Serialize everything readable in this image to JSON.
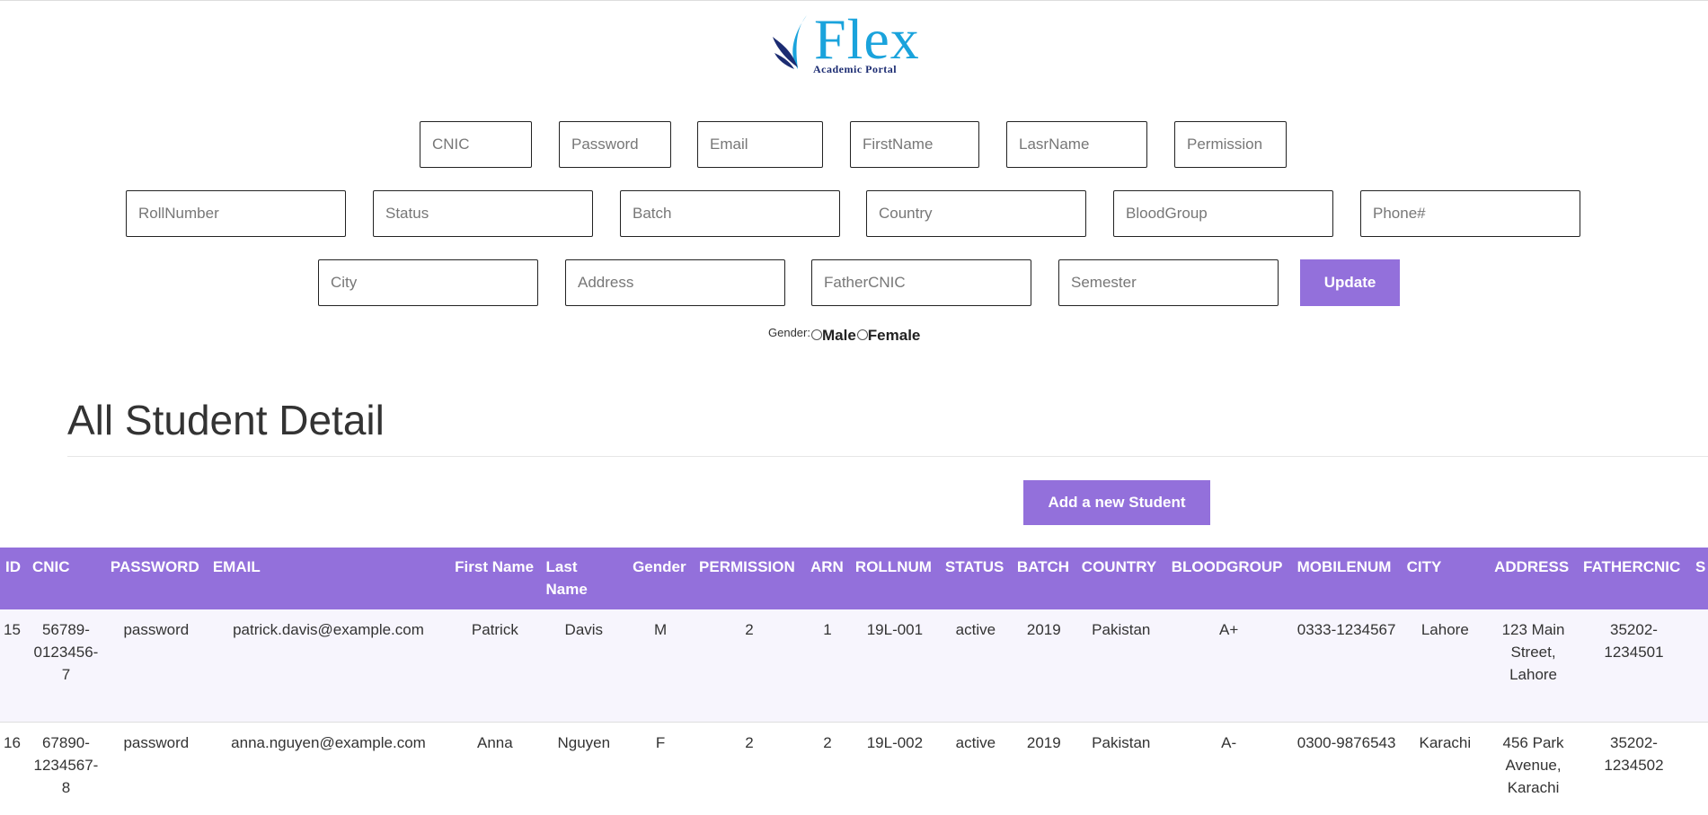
{
  "logo": {
    "brand": "Flex",
    "subtitle": "Academic Portal",
    "colors": {
      "text": "#1aa3dc",
      "mark_dark": "#1c2c72",
      "mark_light": "#1aa3dc"
    }
  },
  "form": {
    "row1": [
      {
        "key": "cnic",
        "placeholder": "CNIC"
      },
      {
        "key": "password",
        "placeholder": "Password"
      },
      {
        "key": "email",
        "placeholder": "Email"
      },
      {
        "key": "firstname",
        "placeholder": "FirstName"
      },
      {
        "key": "lastname",
        "placeholder": "LasrName"
      },
      {
        "key": "permission",
        "placeholder": "Permission"
      }
    ],
    "row2": [
      {
        "key": "rollnumber",
        "placeholder": "RollNumber"
      },
      {
        "key": "status",
        "placeholder": "Status"
      },
      {
        "key": "batch",
        "placeholder": "Batch"
      },
      {
        "key": "country",
        "placeholder": "Country"
      },
      {
        "key": "bloodgroup",
        "placeholder": "BloodGroup"
      },
      {
        "key": "phone",
        "placeholder": "Phone#"
      }
    ],
    "row3": [
      {
        "key": "city",
        "placeholder": "City"
      },
      {
        "key": "address",
        "placeholder": "Address"
      },
      {
        "key": "fathercnic",
        "placeholder": "FatherCNIC"
      },
      {
        "key": "semester",
        "placeholder": "Semester"
      }
    ],
    "update_label": "Update",
    "gender": {
      "label": "Gender:",
      "options": [
        "Male",
        "Female"
      ]
    }
  },
  "section": {
    "title": "All Student Detail",
    "add_button": "Add a new Student"
  },
  "colors": {
    "accent": "#9370db",
    "row_alt": "#f7f5fd"
  },
  "table": {
    "columns": [
      "ID",
      "CNIC",
      "PASSWORD",
      "EMAIL",
      "First Name",
      "Last Name",
      "Gender",
      "PERMISSION",
      "ARN",
      "ROLLNUM",
      "STATUS",
      "BATCH",
      "COUNTRY",
      "BLOODGROUP",
      "MOBILENUM",
      "CITY",
      "ADDRESS",
      "FATHERCNIC",
      "S"
    ],
    "rows": [
      [
        "15",
        "56789-0123456-7",
        "password",
        "patrick.davis@example.com",
        "Patrick",
        "Davis",
        "M",
        "2",
        "1",
        "19L-001",
        "active",
        "2019",
        "Pakistan",
        "A+",
        "0333-1234567",
        "Lahore",
        "123 Main Street, Lahore",
        "35202-1234501",
        ""
      ],
      [
        "16",
        "67890-1234567-8",
        "password",
        "anna.nguyen@example.com",
        "Anna",
        "Nguyen",
        "F",
        "2",
        "2",
        "19L-002",
        "active",
        "2019",
        "Pakistan",
        "A-",
        "0300-9876543",
        "Karachi",
        "456 Park Avenue, Karachi",
        "35202-1234502",
        ""
      ]
    ]
  }
}
